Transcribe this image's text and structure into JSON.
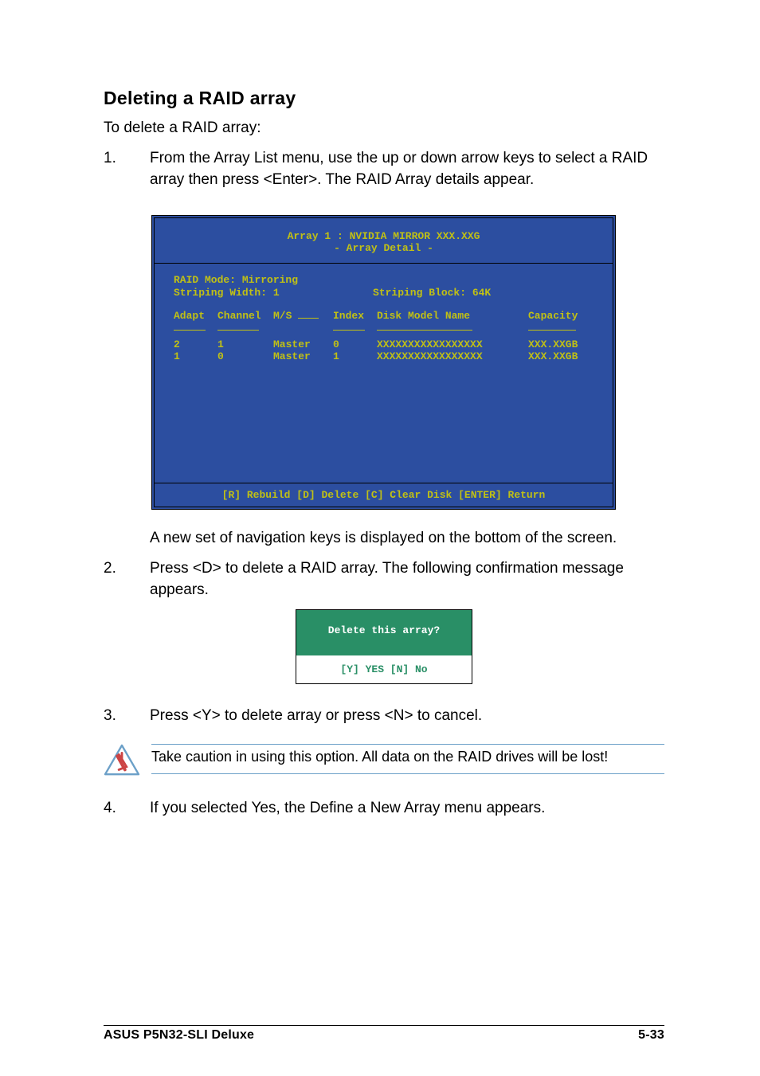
{
  "heading": "Deleting a RAID array",
  "intro": "To delete a RAID array:",
  "steps": {
    "s1": "From the Array List menu, use the up or down arrow keys to select a RAID array then press <Enter>. The RAID Array details appear.",
    "s1after_a": "A new set of  navigation keys is displayed on the bottom of the screen.",
    "s2": "Press <D> to delete a RAID array. The following confirmation message appears.",
    "s3": "Press <Y> to delete array or press <N> to cancel.",
    "s4": "If you selected Yes, the Define a New Array menu appears."
  },
  "panel": {
    "title1": "Array 1 : NVIDIA MIRROR  XXX.XXG",
    "title2": "- Array Detail -",
    "raid_mode": "RAID Mode: Mirroring",
    "striping_width": "Striping Width: 1",
    "striping_block": "Striping Block: 64K",
    "headers": {
      "adapt": "Adapt",
      "channel": "Channel",
      "ms": "M/S",
      "index": "Index",
      "model": "Disk Model Name",
      "capacity": "Capacity"
    },
    "rows": [
      {
        "adapt": "2",
        "channel": "1",
        "ms": "Master",
        "index": "0",
        "model": "XXXXXXXXXXXXXXXXX",
        "capacity": "XXX.XXGB"
      },
      {
        "adapt": "1",
        "channel": "0",
        "ms": "Master",
        "index": "1",
        "model": "XXXXXXXXXXXXXXXXX",
        "capacity": "XXX.XXGB"
      }
    ],
    "footer": "[R] Rebuild  [D] Delete  [C] Clear Disk  [ENTER] Return"
  },
  "dialog": {
    "question": "Delete this array?",
    "yesno": "[Y] YES   [N] No"
  },
  "caution_text": "Take caution in using this option. All data on the RAID drives will be lost!",
  "footer_left": "ASUS P5N32-SLI Deluxe",
  "footer_right": "5-33",
  "chart_data": {
    "type": "table",
    "title": "Array 1 : NVIDIA MIRROR  XXX.XXG - Array Detail",
    "columns": [
      "Adapt",
      "Channel",
      "M/S",
      "Index",
      "Disk Model Name",
      "Capacity"
    ],
    "rows": [
      [
        "2",
        "1",
        "Master",
        "0",
        "XXXXXXXXXXXXXXXXX",
        "XXX.XXGB"
      ],
      [
        "1",
        "0",
        "Master",
        "1",
        "XXXXXXXXXXXXXXXXX",
        "XXX.XXGB"
      ]
    ],
    "meta": {
      "RAID Mode": "Mirroring",
      "Striping Width": "1",
      "Striping Block": "64K"
    }
  }
}
